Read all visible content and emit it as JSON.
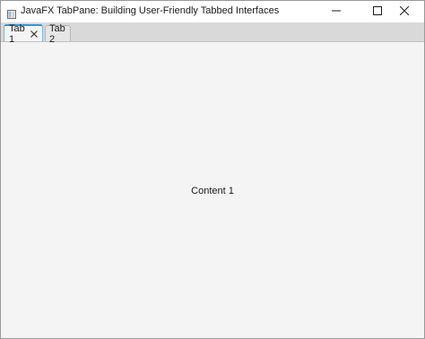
{
  "window": {
    "title": "JavaFX TabPane: Building User-Friendly Tabbed Interfaces",
    "app_icon": "java-app-icon",
    "controls": [
      "minimize-icon",
      "maximize-icon",
      "close-icon"
    ]
  },
  "tabs": [
    {
      "label": "Tab 1",
      "selected": true,
      "closable": true,
      "close_icon": "close-icon"
    },
    {
      "label": "Tab 2",
      "selected": false,
      "closable": false
    }
  ],
  "content": {
    "text": "Content 1"
  },
  "colors": {
    "accent": "#3c92d6",
    "tab_bar": "#d9d9d9",
    "background": "#f4f4f4"
  }
}
